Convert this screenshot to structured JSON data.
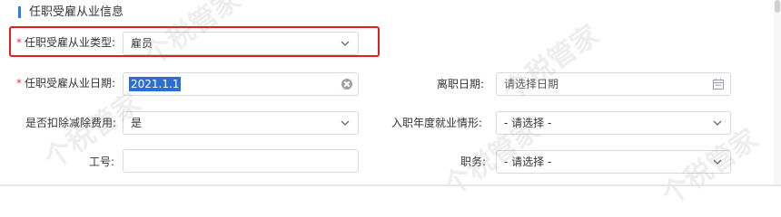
{
  "section": {
    "title": "任职受雇从业信息"
  },
  "form": {
    "employment_type": {
      "label": "任职受雇从业类型:",
      "value": "雇员",
      "required": true
    },
    "employment_date": {
      "label": "任职受雇从业日期:",
      "value": "2021.1.1",
      "required": true
    },
    "leave_date": {
      "label": "离职日期:",
      "placeholder": "请选择日期"
    },
    "deduct_fee": {
      "label": "是否扣除减除费用:",
      "value": "是"
    },
    "entry_situation": {
      "label": "入职年度就业情形:",
      "value": "- 请选择 -"
    },
    "employee_no": {
      "label": "工号:",
      "value": ""
    },
    "position": {
      "label": "职务:",
      "value": "- 请选择 -"
    }
  },
  "watermark": {
    "text": "个税管家"
  },
  "colors": {
    "accent": "#2b7de9",
    "required": "#e6393f",
    "highlight": "#e02020"
  }
}
